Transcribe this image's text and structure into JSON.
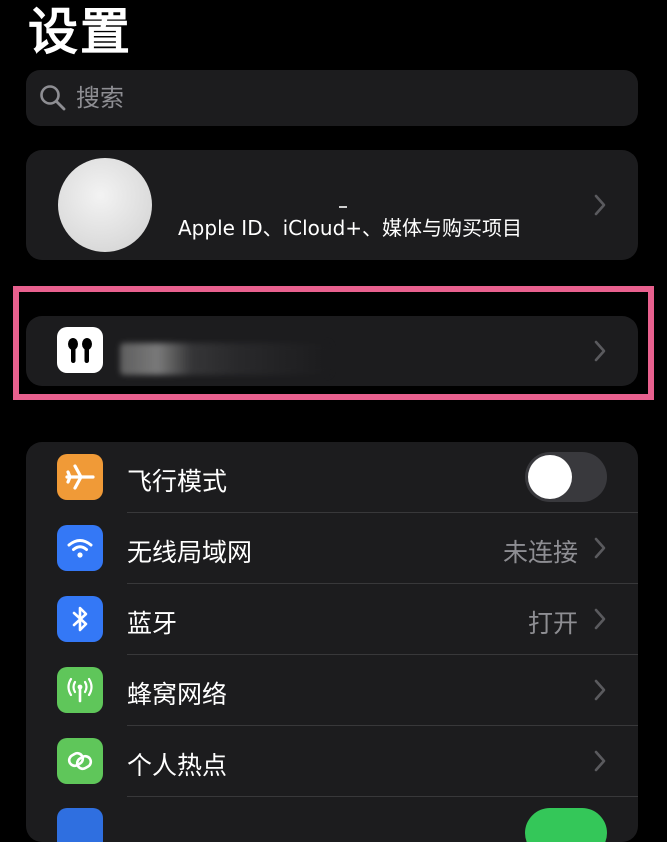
{
  "page": {
    "title": "设置"
  },
  "search": {
    "placeholder": "搜索"
  },
  "account": {
    "subtitle": "Apple ID、iCloud+、媒体与购买项目"
  },
  "settings_rows": [
    {
      "label": "飞行模式",
      "icon": "airplane-icon",
      "icon_color": "#f09a37",
      "toggle_on": false
    },
    {
      "label": "无线局域网",
      "value": "未连接",
      "icon": "wifi-icon",
      "icon_color": "#3478f6"
    },
    {
      "label": "蓝牙",
      "value": "打开",
      "icon": "bluetooth-icon",
      "icon_color": "#3478f6"
    },
    {
      "label": "蜂窝网络",
      "icon": "cellular-antenna-icon",
      "icon_color": "#5fc65a"
    },
    {
      "label": "个人热点",
      "icon": "hotspot-link-icon",
      "icon_color": "#5fc65a"
    }
  ],
  "colors": {
    "background": "#000000",
    "card": "#1c1c1e",
    "secondary_text": "#8e8e93",
    "highlight_frame": "#e8608e"
  }
}
